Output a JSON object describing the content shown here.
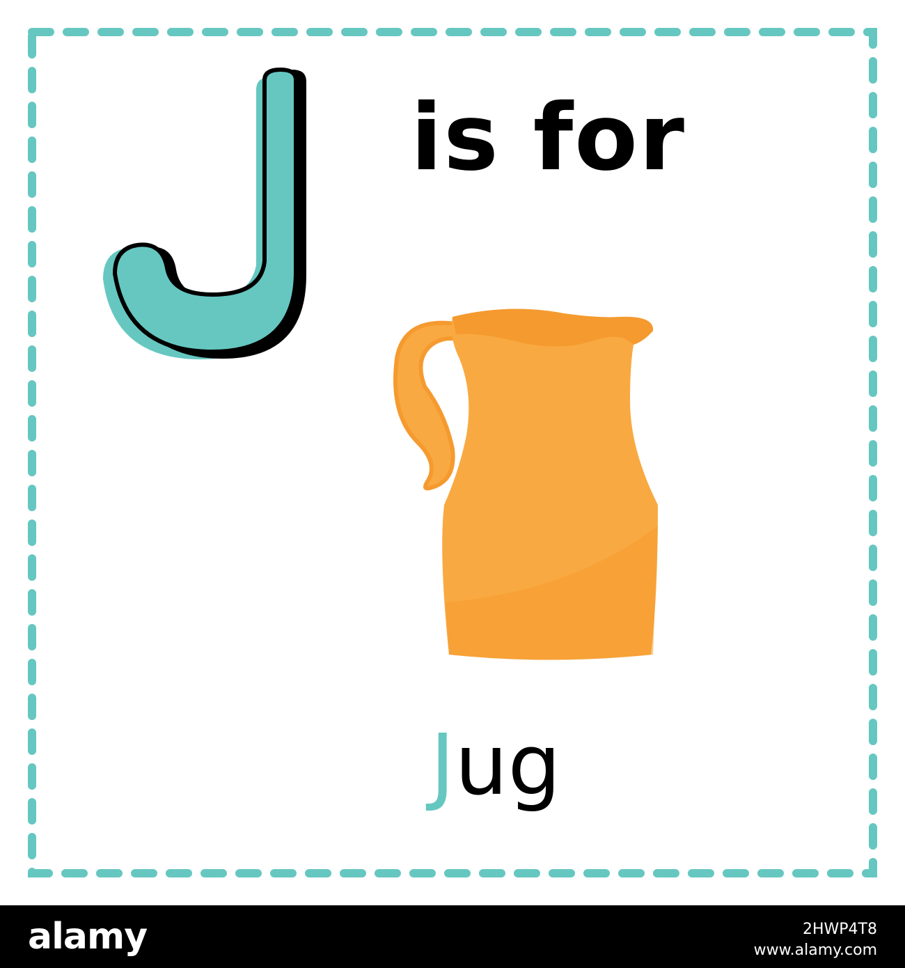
{
  "card": {
    "letter": "J",
    "headline": "is for",
    "word_first_letter": "J",
    "word_rest": "ug",
    "illustration": "jug-illustration"
  },
  "colors": {
    "accent": "#66c7c1",
    "text": "#000000",
    "jug_body": "#f9a941",
    "jug_dark": "#f59a2f"
  },
  "watermark": {
    "logo": "alamy",
    "image_id": "2HWP4T8",
    "site": "www.alamy.com"
  }
}
